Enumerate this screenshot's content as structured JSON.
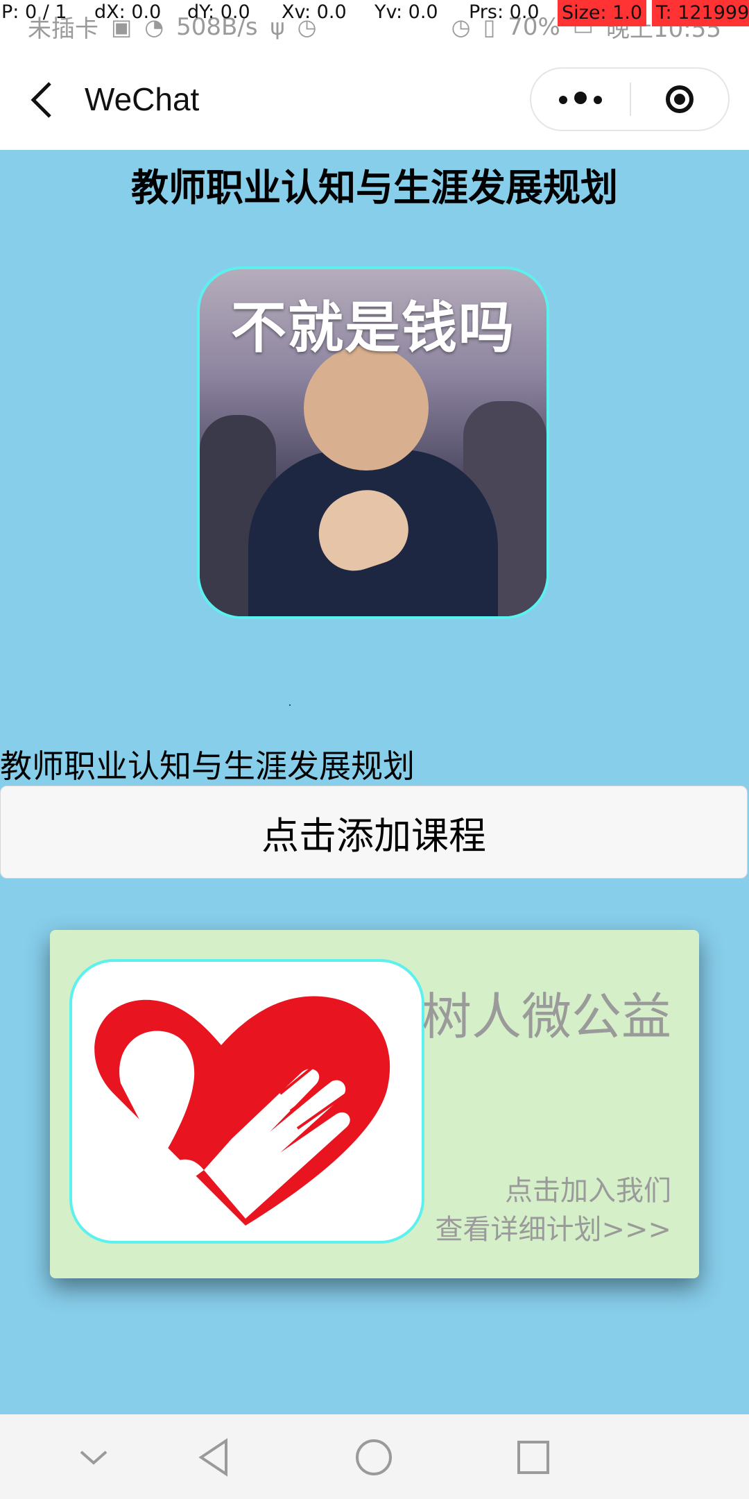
{
  "status_bar": {
    "carrier": "未插卡",
    "net_speed": "508B/s",
    "battery": "70%",
    "time": "晚上10:55"
  },
  "debug_overlay": {
    "p": "P: 0 / 1",
    "dx": "dX: 0.0",
    "dy": "dY: 0.0",
    "xv": "Xv: 0.0",
    "yv": "Yv: 0.0",
    "prs": "Prs: 0.0",
    "size": "Size: 1.0",
    "t": "T: 121999"
  },
  "nav": {
    "title": "WeChat",
    "back_icon": "chevron-left-icon",
    "more_icon": "more-dots-icon",
    "close_icon": "target-close-icon"
  },
  "page": {
    "title": "教师职业认知与生涯发展规划",
    "hero_caption": "不就是钱吗",
    "course_label": "教师职业认知与生涯发展规划",
    "add_course_button": "点击添加课程"
  },
  "card": {
    "title": "树人微公益",
    "join_text": "点击加入我们",
    "detail_text": "查看详细计划>>>",
    "logo_icon": "charity-heart-hand-icon"
  },
  "colors": {
    "page_bg": "#87ceeb",
    "image_border": "#5cf0ef",
    "card_bg": "#d5f0c8",
    "logo_red": "#e8141f"
  },
  "system_nav": {
    "icons": [
      "chevron-down-icon",
      "back-triangle-icon",
      "home-circle-icon",
      "recents-square-icon"
    ]
  }
}
